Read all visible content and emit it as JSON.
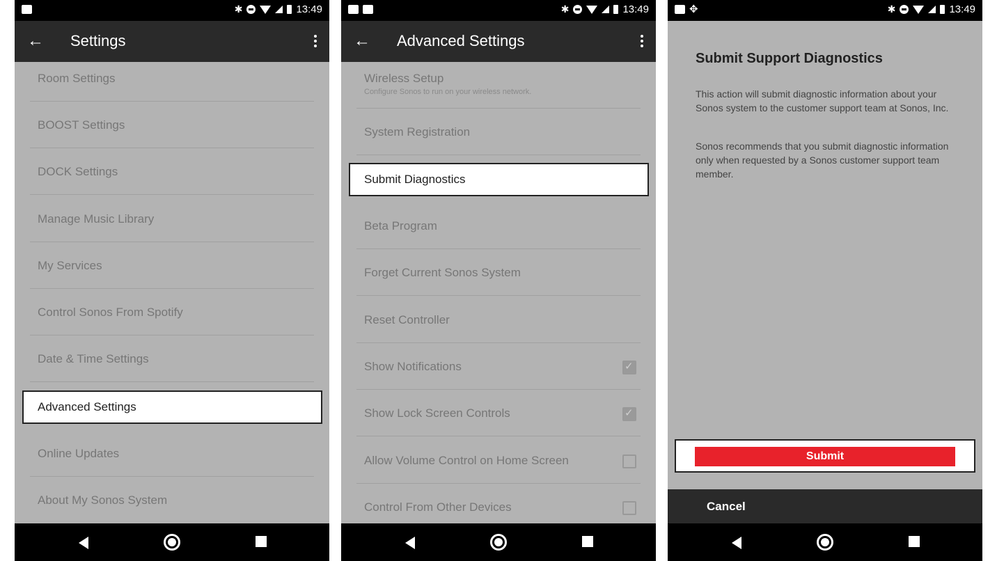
{
  "status_bar": {
    "time": "13:49"
  },
  "screens": [
    {
      "title": "Settings",
      "items": [
        "Room Settings",
        "BOOST Settings",
        "DOCK Settings",
        "Manage Music Library",
        "My Services",
        "Control Sonos From Spotify",
        "Date & Time Settings",
        "Advanced Settings",
        "Online Updates",
        "About My Sonos System"
      ],
      "highlighted_item": "Advanced Settings"
    },
    {
      "title": "Advanced Settings",
      "items": [
        {
          "label": "Wireless Setup",
          "sublabel": "Configure Sonos to run on your wireless network."
        },
        {
          "label": "System Registration"
        },
        {
          "label": "Submit Diagnostics"
        },
        {
          "label": "Beta Program"
        },
        {
          "label": "Forget Current Sonos System"
        },
        {
          "label": "Reset Controller"
        },
        {
          "label": "Show Notifications",
          "checked": true
        },
        {
          "label": "Show Lock Screen Controls",
          "checked": true
        },
        {
          "label": "Allow Volume Control on Home Screen",
          "checked": false
        },
        {
          "label": "Control From Other Devices",
          "checked": false
        }
      ],
      "highlighted_item": "Submit Diagnostics"
    },
    {
      "title": "Submit Support Diagnostics",
      "paragraphs": [
        "This action will submit diagnostic information about your Sonos system to the customer support team at Sonos, Inc.",
        "Sonos recommends that you submit diagnostic information only when requested by a Sonos customer support team member."
      ],
      "submit_label": "Submit",
      "cancel_label": "Cancel",
      "submit_color": "#e8222b"
    }
  ]
}
